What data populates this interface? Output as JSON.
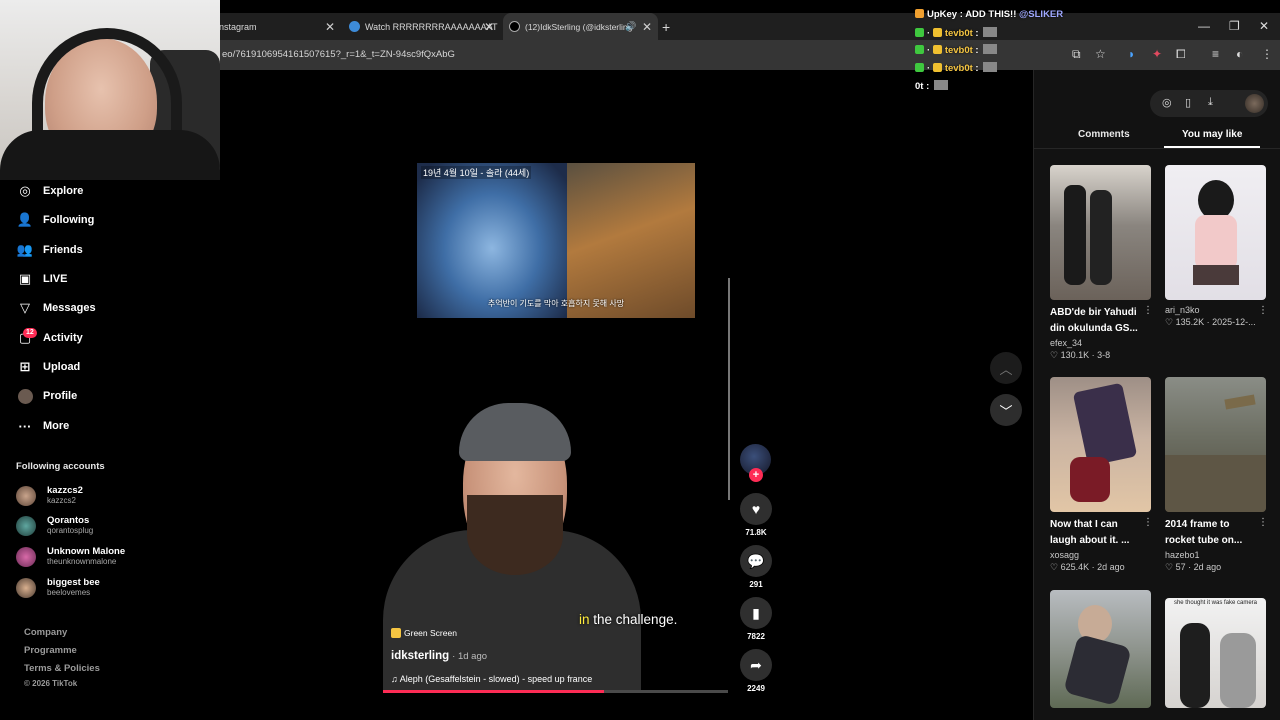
{
  "browser": {
    "tabs": [
      {
        "label": "nstagram",
        "active": false
      },
      {
        "label": "Watch RRRRRRRRAAAAAAAAT",
        "active": false
      },
      {
        "label": "(12)IdkSterling (@idksterling",
        "active": true
      }
    ],
    "new_tab": "+",
    "url": "eo/7619106954161507615?_r=1&_t=ZN-94sc9fQxAbG"
  },
  "chat": {
    "lines": [
      {
        "user": "UpKey",
        "message": "ADD THIS!! @SLIKER"
      },
      {
        "user": "tevb0t",
        "message": ""
      },
      {
        "user": "tevb0t",
        "message": ""
      },
      {
        "user": "tevb0t",
        "message": ""
      },
      {
        "user": "0t",
        "message": ""
      }
    ]
  },
  "sidebar": {
    "nav": [
      {
        "label": "Explore",
        "icon": "compass-icon"
      },
      {
        "label": "Following",
        "icon": "following-icon"
      },
      {
        "label": "Friends",
        "icon": "friends-icon"
      },
      {
        "label": "LIVE",
        "icon": "live-icon"
      },
      {
        "label": "Messages",
        "icon": "messages-icon"
      },
      {
        "label": "Activity",
        "icon": "activity-icon"
      },
      {
        "label": "Upload",
        "icon": "upload-icon"
      },
      {
        "label": "Profile",
        "icon": "profile-icon"
      },
      {
        "label": "More",
        "icon": "more-icon"
      }
    ],
    "activity_badge": "12",
    "following_title": "Following accounts",
    "accounts": [
      {
        "name": "kazzcs2",
        "handle": "kazzcs2"
      },
      {
        "name": "Qorantos",
        "handle": "qorantosplug"
      },
      {
        "name": "Unknown Malone",
        "handle": "theunknownmalone"
      },
      {
        "name": "biggest bee",
        "handle": "beelovemes"
      }
    ],
    "footer": [
      "Company",
      "Programme",
      "Terms & Policies"
    ],
    "copyright": "© 2026 TikTok"
  },
  "video": {
    "inset_date": "19년 4월 10일 - 솔라 (44세)",
    "inset_subtitle": "추억반이 기도를 막아 호흡하지 못해 사망",
    "caption_highlight": "in",
    "caption_rest": " the challenge.",
    "effect_label": "Green Screen",
    "author": "idksterling",
    "post_time": "· 1d ago",
    "music": "Aleph (Gesaffelstein - slowed) - speed up france",
    "progress": 0.64
  },
  "actions": {
    "likes": "71.8K",
    "comments": "291",
    "saves": "7822",
    "shares": "2249"
  },
  "right_panel": {
    "tabs": [
      "Comments",
      "You may like"
    ],
    "active_tab": "You may like",
    "cards": [
      {
        "title": "ABD'de bir Yahudi din okulunda GS...",
        "user": "efex_34",
        "likes": "130.1K",
        "date": "3-8"
      },
      {
        "title": "",
        "user": "ari_n3ko",
        "likes": "135.2K",
        "date": "2025-12-..."
      },
      {
        "title": "Now that I can laugh about it. ...",
        "user": "xosagg",
        "likes": "625.4K",
        "date": "2d ago"
      },
      {
        "title": "2014 frame to rocket tube on...",
        "user": "hazebo1",
        "likes": "57",
        "date": "2d ago"
      },
      {
        "title": "",
        "user": "",
        "likes": "",
        "date": ""
      },
      {
        "title": "",
        "user": "",
        "likes": "",
        "date": ""
      }
    ],
    "card6_overlay": "she thought it was fake camera"
  },
  "colors": {
    "accent": "#fe2c55",
    "caption_highlight": "#ffec3d",
    "background": "#000000",
    "panel": "#121212"
  }
}
